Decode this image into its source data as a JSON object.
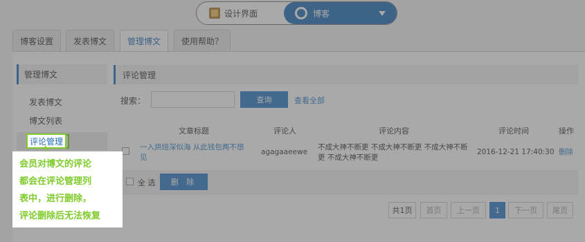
{
  "switcher": {
    "design_label": "设计界面",
    "blog_label": "博客"
  },
  "tabs": [
    {
      "label": "博客设置"
    },
    {
      "label": "发表博文"
    },
    {
      "label": "管理博文"
    },
    {
      "label": "使用帮助？"
    }
  ],
  "sidebar": {
    "title": "管理博文",
    "items": [
      {
        "label": "发表博文"
      },
      {
        "label": "博文列表"
      },
      {
        "label": "评论管理"
      }
    ]
  },
  "main": {
    "title": "评论管理",
    "search_label": "搜索：",
    "search_value": "",
    "query_button": "查询",
    "view_all_link": "查看全部"
  },
  "table": {
    "headers": {
      "title": "文章标题",
      "commenter": "评论人",
      "content": "评论内容",
      "time": "评论时间",
      "action": "操作"
    },
    "rows": [
      {
        "title": "一入烘焙深似海 从此钱包两不想见",
        "commenter": "agagaaeewe",
        "content": "不成大神不断更 不成大神不断更 不成大神不断更 不成大神不断更",
        "time": "2016-12-21 17:40:30",
        "action": "删除"
      }
    ]
  },
  "bulk": {
    "select_all": "全 选",
    "delete_button": "删 除"
  },
  "pagination": {
    "total": "共1页",
    "first": "首页",
    "prev": "上一页",
    "current": "1",
    "next": "下一页",
    "last": "尾页"
  },
  "callout": {
    "lines": [
      "会员对博文的评论",
      "都会在评论管理列",
      "表中，进行删除，",
      "评论删除后无法恢复"
    ]
  }
}
